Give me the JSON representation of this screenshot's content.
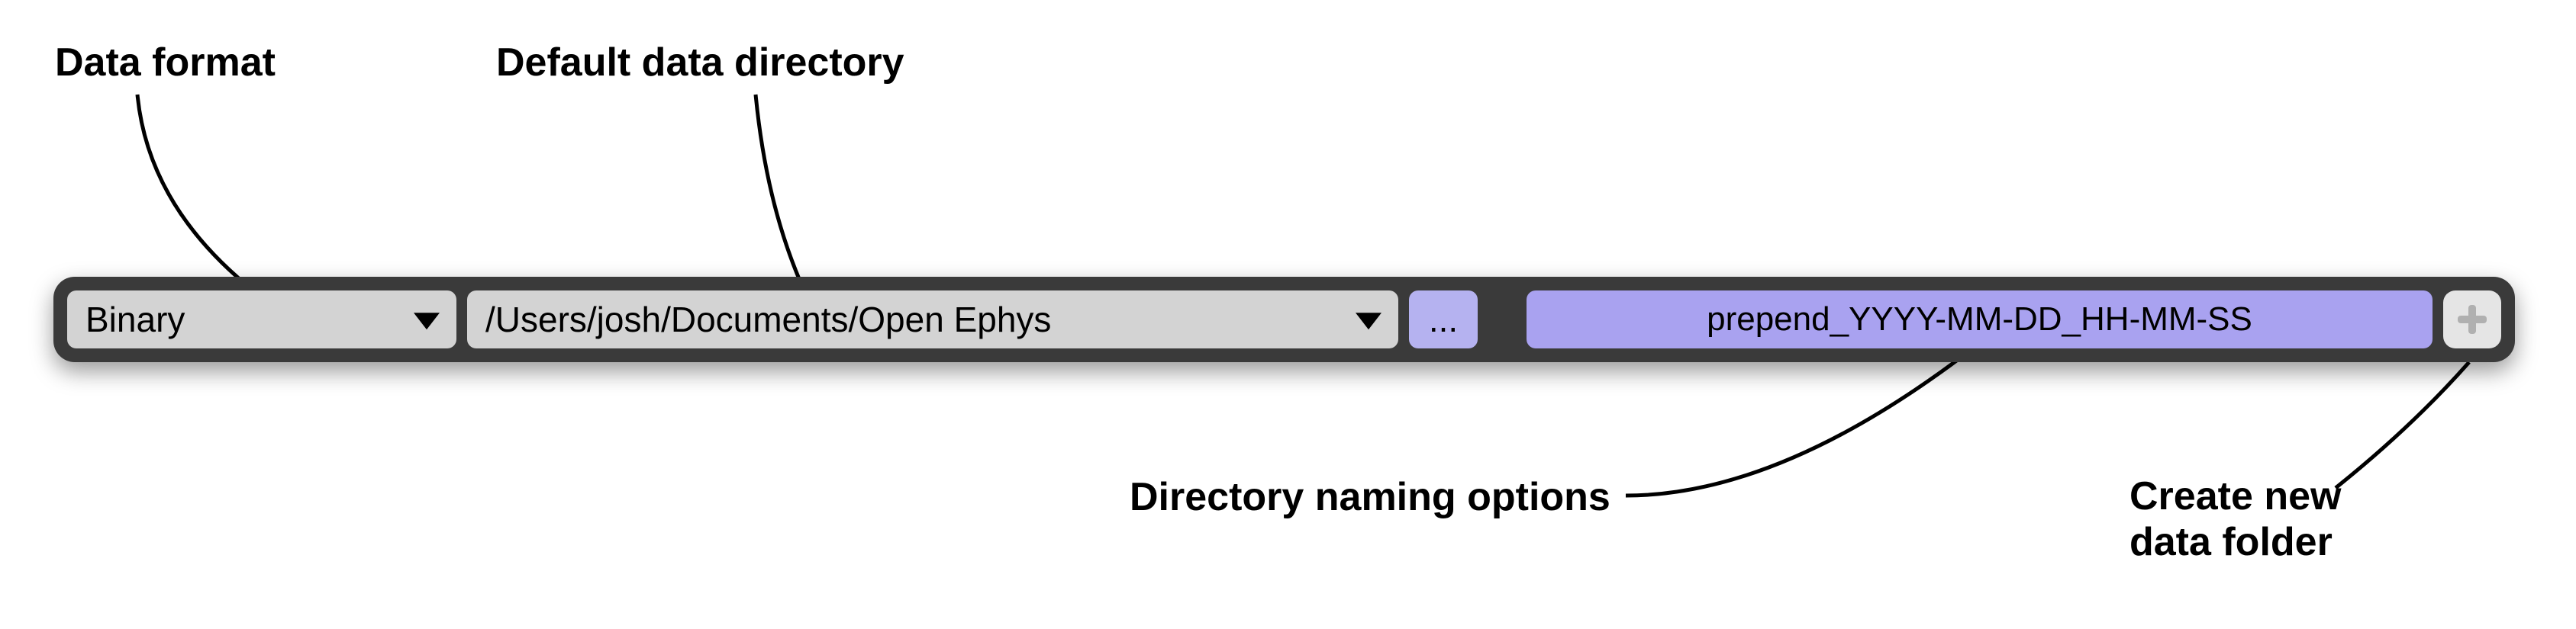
{
  "annotations": {
    "data_format": "Data format",
    "default_dir": "Default data directory",
    "naming_options": "Directory naming options",
    "create_folder_line1": "Create new",
    "create_folder_line2": "data folder"
  },
  "toolbar": {
    "format_value": "Binary",
    "directory_value": "/Users/josh/Documents/Open Ephys",
    "browse_label": "...",
    "naming_pattern": "prepend_YYYY-MM-DD_HH-MM-SS"
  }
}
